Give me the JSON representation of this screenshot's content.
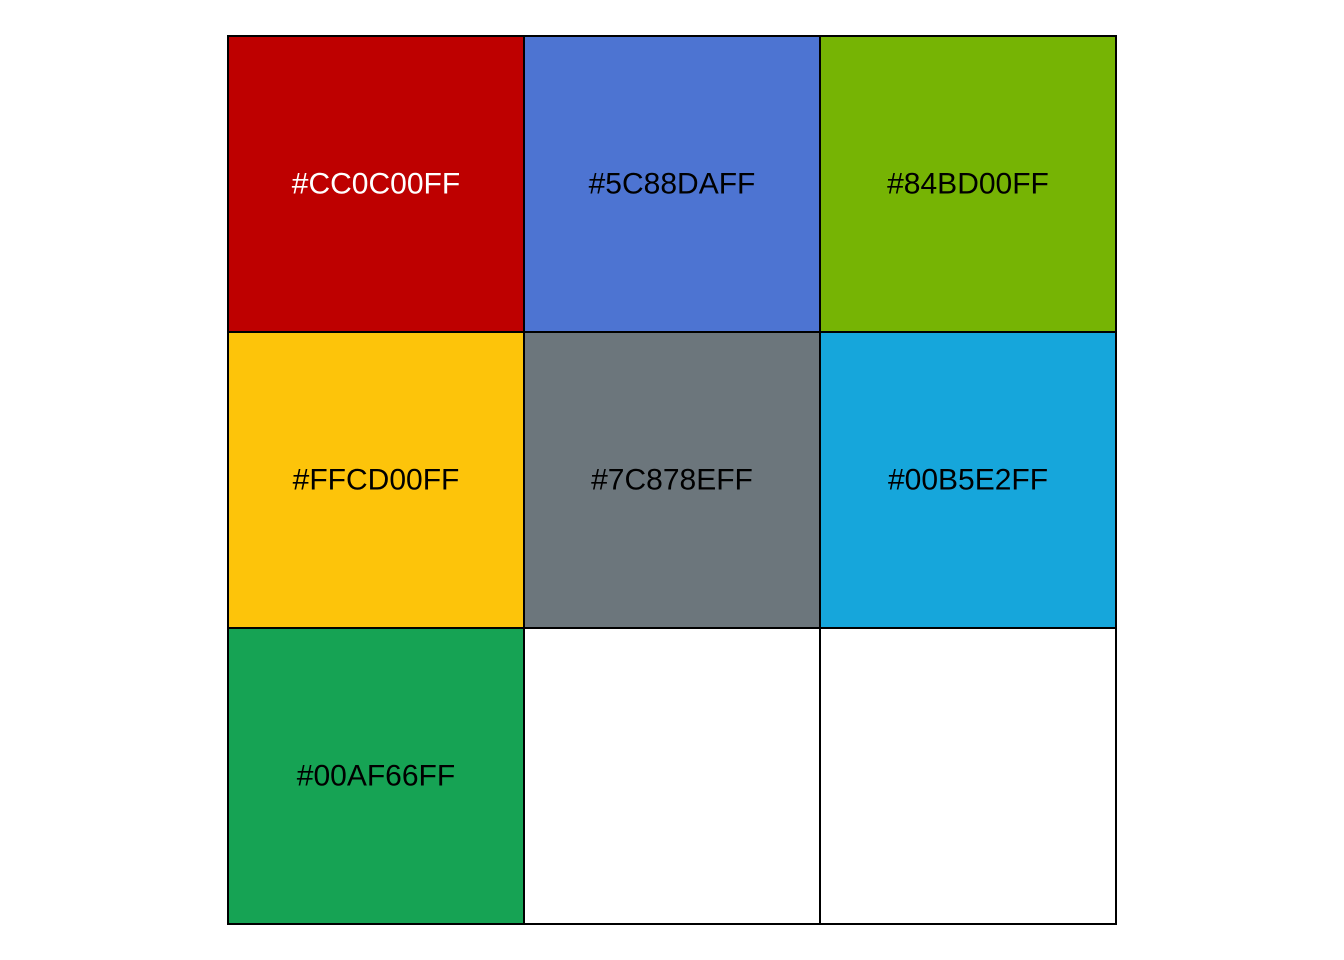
{
  "chart_data": {
    "type": "table",
    "rows": 3,
    "cols": 3,
    "swatches": [
      {
        "label": "#CC0C00FF",
        "fill": "#BE0000",
        "text_color": "#FFFFFF"
      },
      {
        "label": "#5C88DAFF",
        "fill": "#4D74D2",
        "text_color": "#000000"
      },
      {
        "label": "#84BD00FF",
        "fill": "#76B404",
        "text_color": "#000000"
      },
      {
        "label": "#FFCD00FF",
        "fill": "#FDC40A",
        "text_color": "#000000"
      },
      {
        "label": "#7C878EFF",
        "fill": "#6C767C",
        "text_color": "#000000"
      },
      {
        "label": "#00B5E2FF",
        "fill": "#16A6DB",
        "text_color": "#000000"
      },
      {
        "label": "#00AF66FF",
        "fill": "#16A354",
        "text_color": "#000000"
      }
    ],
    "empty_cell_fill": "#FFFFFF",
    "border_color": "#000000"
  }
}
